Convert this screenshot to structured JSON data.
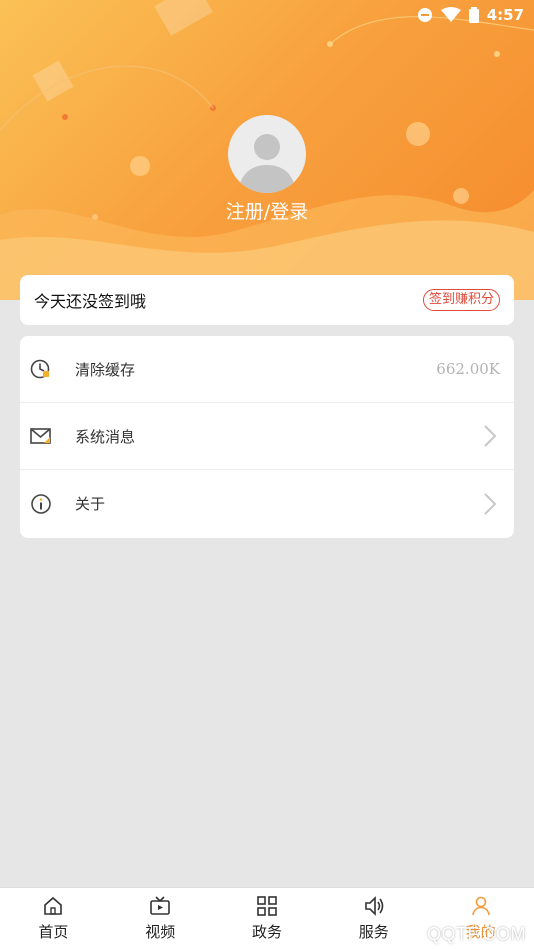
{
  "status_bar": {
    "time": "4:57"
  },
  "profile": {
    "login_label": "注册/登录"
  },
  "checkin": {
    "text": "今天还没签到哦",
    "button_label": "签到赚积分"
  },
  "menu": {
    "items": [
      {
        "label": "清除缓存",
        "value": "662.00K",
        "icon": "clock-clear-icon"
      },
      {
        "label": "系统消息",
        "icon": "envelope-icon"
      },
      {
        "label": "关于",
        "icon": "info-icon"
      }
    ]
  },
  "bottom_nav": {
    "items": [
      {
        "label": "首页",
        "icon": "home-icon"
      },
      {
        "label": "视频",
        "icon": "tv-icon"
      },
      {
        "label": "政务",
        "icon": "grid-icon"
      },
      {
        "label": "服务",
        "icon": "speaker-icon"
      },
      {
        "label": "我的",
        "icon": "person-icon",
        "active": true
      }
    ]
  },
  "watermark": "QQTF.COM",
  "colors": {
    "accent": "#f39a3c",
    "badge_red": "#e04a3a",
    "background": "#e6e6e6"
  }
}
